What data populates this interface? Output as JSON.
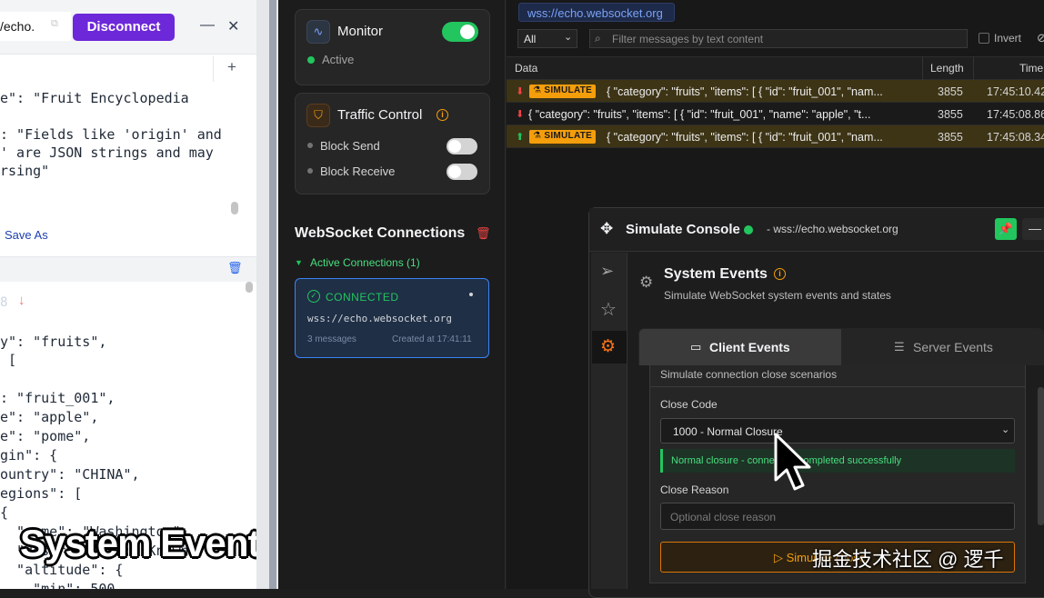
{
  "left_panel": {
    "url_partial": "/echo.",
    "disconnect_label": "Disconnect",
    "min_glyph": "—",
    "close_glyph": "✕",
    "add_glyph": "+",
    "code_top": [
      "e\": \"Fruit Encyclopedia",
      "",
      ": \"Fields like 'origin' and",
      "' are JSON strings and may",
      "rsing\""
    ],
    "save_as_label": "Save As",
    "row_indicator": "8",
    "code_bottom": [
      "y\": \"fruits\",",
      " [",
      "",
      ": \"fruit_001\",",
      "e\": \"apple\",",
      "e\": \"pome\",",
      "gin\": {",
      "ountry\": \"CHINA\",",
      "egions\": [",
      "{",
      "  \"name\": \"Washington\",",
      "  \"description\": \"Known",
      "  \"altitude\": {",
      "    \"min\": 500,"
    ],
    "caption": "System Event"
  },
  "sidebar": {
    "monitor": {
      "title": "Monitor",
      "status": "Active",
      "enabled": true
    },
    "traffic_control": {
      "title": "Traffic Control",
      "rows": [
        {
          "label": "Block Send",
          "enabled": false
        },
        {
          "label": "Block Receive",
          "enabled": false
        }
      ]
    },
    "connections_title": "WebSocket Connections",
    "active_connections_label": "Active Connections (1)",
    "connection": {
      "status": "CONNECTED",
      "url": "wss://echo.websocket.org",
      "messages": "3 messages",
      "created": "Created at 17:41:11"
    }
  },
  "messages": {
    "url_badge": "wss://echo.websocket.org",
    "filter_type": "All",
    "filter_placeholder": "Filter messages by text content",
    "invert_label": "Invert",
    "columns": {
      "data": "Data",
      "length": "Length",
      "time": "Time"
    },
    "rows": [
      {
        "direction": "receive",
        "simulated": true,
        "badge": "SIMULATE",
        "data": "{ \"category\": \"fruits\", \"items\": [ { \"id\": \"fruit_001\", \"nam...",
        "length": "3855",
        "time": "17:45:10.42"
      },
      {
        "direction": "receive",
        "simulated": false,
        "badge": "",
        "data": "{ \"category\": \"fruits\", \"items\": [ { \"id\": \"fruit_001\", \"name\": \"apple\", \"t...",
        "length": "3855",
        "time": "17:45:08.86"
      },
      {
        "direction": "send",
        "simulated": true,
        "badge": "SIMULATE",
        "data": "{ \"category\": \"fruits\", \"items\": [ { \"id\": \"fruit_001\", \"nam...",
        "length": "3855",
        "time": "17:45:08.34"
      }
    ]
  },
  "console": {
    "title": "Simulate Console",
    "url": "- wss://echo.websocket.org",
    "section_title": "System Events",
    "section_subtitle": "Simulate WebSocket system events and states",
    "tabs": [
      {
        "label": "Client Events",
        "active": true
      },
      {
        "label": "Server Events",
        "active": false
      }
    ],
    "close_description": "Simulate connection close scenarios",
    "close_code_label": "Close Code",
    "close_code_value": "1000 - Normal Closure",
    "close_code_hint": "Normal closure - connection completed successfully",
    "close_reason_label": "Close Reason",
    "close_reason_placeholder": "Optional close reason",
    "simulate_button": "Simulate Close"
  },
  "watermark": "掘金技术社区 @ 逻千",
  "colors": {
    "accent_purple": "#6d28d9",
    "success_green": "#22c55e",
    "simulate_amber": "#f59e0b",
    "link_blue": "#3b82f6"
  }
}
